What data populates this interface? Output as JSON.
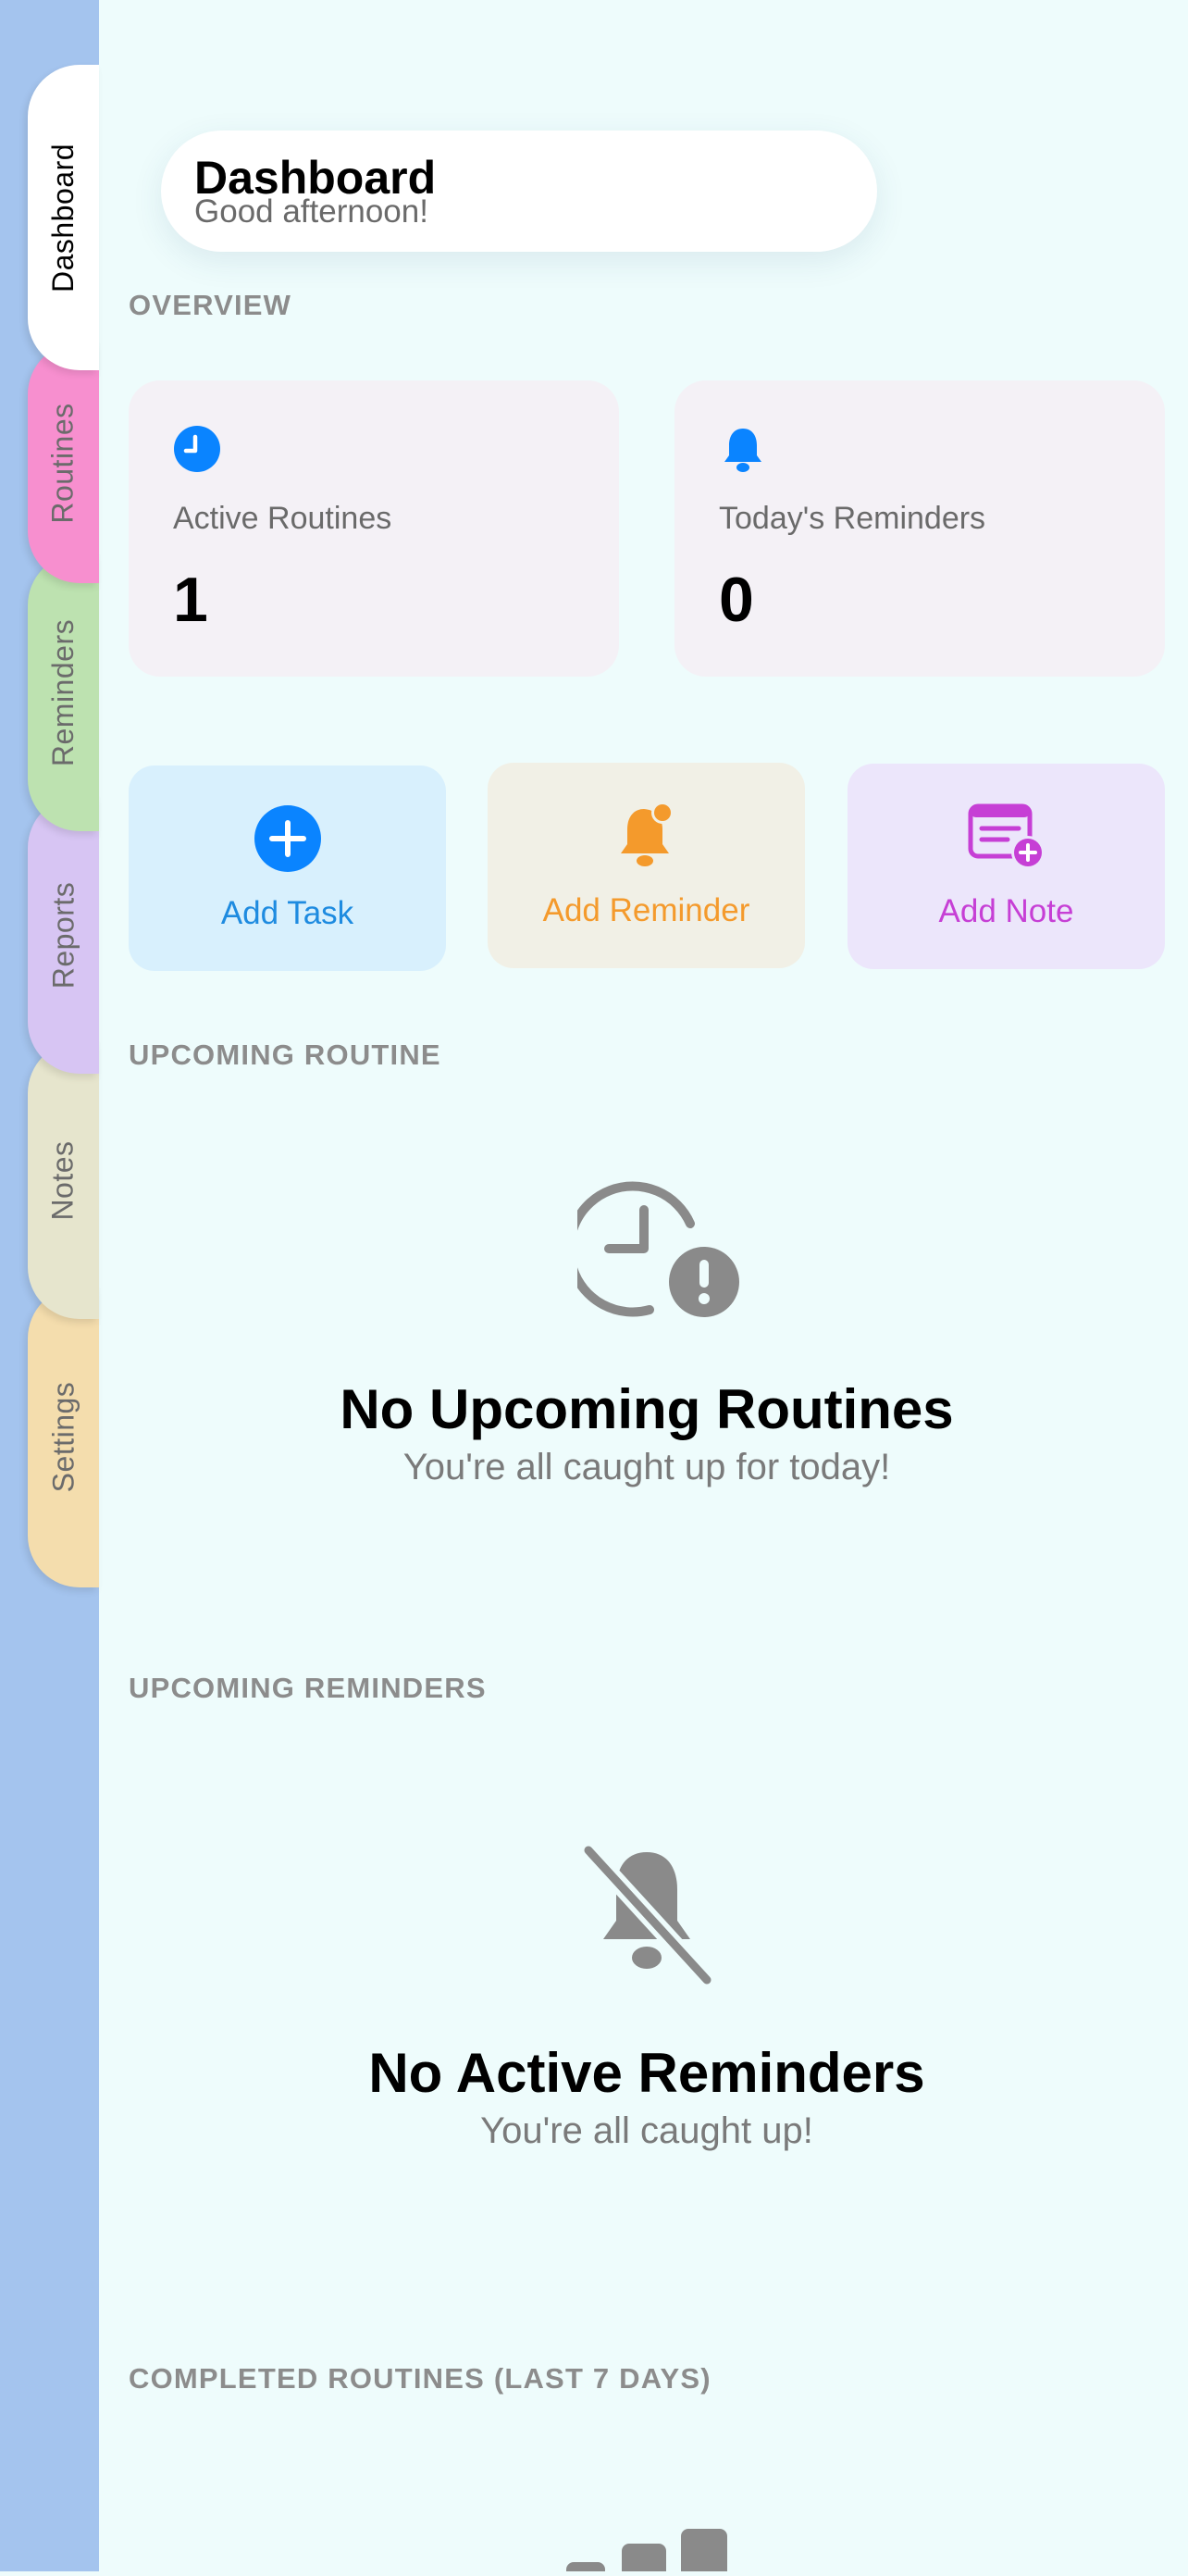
{
  "nav": {
    "tabs": [
      {
        "label": "Dashboard",
        "color": "#FFFFFF"
      },
      {
        "label": "Routines",
        "color": "#F78FCF"
      },
      {
        "label": "Reminders",
        "color": "#BDE2B0"
      },
      {
        "label": "Reports",
        "color": "#D7C5F3"
      },
      {
        "label": "Notes",
        "color": "#E6E5CD"
      },
      {
        "label": "Settings",
        "color": "#F4DDAD"
      }
    ],
    "active": "Dashboard"
  },
  "header": {
    "title": "Dashboard",
    "subtitle": "Good afternoon!"
  },
  "overview": {
    "label": "OVERVIEW",
    "cards": [
      {
        "label": "Active Routines",
        "value": "1",
        "icon": "clock-icon"
      },
      {
        "label": "Today's Reminders",
        "value": "0",
        "icon": "bell-icon"
      }
    ]
  },
  "actions": [
    {
      "label": "Add Task",
      "icon": "plus-circle-icon",
      "color": "#1E8BE0",
      "bg": "#D8F0FD"
    },
    {
      "label": "Add Reminder",
      "icon": "bell-badge-icon",
      "color": "#F49A2C",
      "bg": "#F1F0E6"
    },
    {
      "label": "Add Note",
      "icon": "note-add-icon",
      "color": "#C63FD5",
      "bg": "#ECE6FB"
    }
  ],
  "upcoming_routine": {
    "label": "UPCOMING ROUTINE",
    "empty_title": "No Upcoming Routines",
    "empty_sub": "You're all caught up for today!",
    "icon": "clock-alert-icon"
  },
  "upcoming_reminders": {
    "label": "UPCOMING REMINDERS",
    "empty_title": "No Active Reminders",
    "empty_sub": "You're all caught up!",
    "icon": "bell-slash-icon"
  },
  "completed": {
    "label": "COMPLETED ROUTINES (LAST 7 DAYS)",
    "icon": "bar-chart-icon"
  },
  "colors": {
    "accent": "#0A84FF",
    "background": "#EEFCFC",
    "sidebar": "#A4C4EE",
    "muted": "#8C8C8C"
  }
}
